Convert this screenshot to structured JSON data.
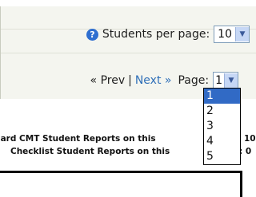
{
  "students_per_page": {
    "label": "Students per page:",
    "selected": "10",
    "help_icon": "help-icon"
  },
  "pager": {
    "prev_label": "« Prev",
    "separator": "|",
    "next_label": "Next »",
    "page_label": "Page:",
    "current_page": "1",
    "page_options": [
      "1",
      "2",
      "3",
      "4",
      "5"
    ]
  },
  "reports": {
    "line1_text": "lard CMT Student Reports on this",
    "line1_count": "10",
    "line2_text": "Checklist Student Reports on this",
    "line2_count": ": 0"
  },
  "colors": {
    "panel_bg": "#f4f5ef",
    "link": "#2f6fb8",
    "highlight": "#316ac5"
  }
}
